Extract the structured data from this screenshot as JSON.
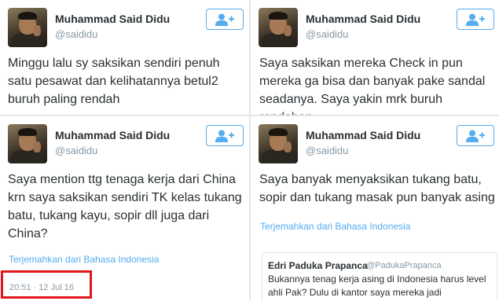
{
  "colors": {
    "accent": "#55acee",
    "highlight": "#e0161b",
    "text": "#292f33",
    "muted": "#8899a6"
  },
  "tweets": [
    {
      "name": "Muhammad Said Didu",
      "handle": "@saididu",
      "follow_icon": "follow-person-icon",
      "text": "Minggu lalu sy saksikan sendiri penuh satu pesawat dan kelihatannya betul2 buruh paling rendah"
    },
    {
      "name": "Muhammad Said Didu",
      "handle": "@saididu",
      "follow_icon": "follow-person-icon",
      "text": "Saya saksikan mereka Check in pun mereka ga bisa dan banyak pake sandal seadanya. Saya yakin mrk buruh rendahan"
    },
    {
      "name": "Muhammad Said Didu",
      "handle": "@saididu",
      "follow_icon": "follow-person-icon",
      "text": "Saya mention ttg tenaga kerja dari China krn saya saksikan sendiri TK kelas tukang batu, tukang kayu, sopir dll juga dari China?",
      "translate": "Terjemahkan dari Bahasa Indonesia",
      "timestamp": "20:51 · 12 Jul 16"
    },
    {
      "name": "Muhammad Said Didu",
      "handle": "@saididu",
      "follow_icon": "follow-person-icon",
      "text": "Saya banyak menyaksikan tukang batu, sopir dan tukang masak pun banyak asing",
      "translate": "Terjemahkan dari Bahasa Indonesia",
      "quote": {
        "name": "Edri Paduka Prapanca",
        "handle": "@PadukaPrapanca",
        "text": "Bukannya tenag kerja asing di Indonesia harus level ahli Pak? Dulu di kantor saya mereka jadi"
      }
    }
  ]
}
